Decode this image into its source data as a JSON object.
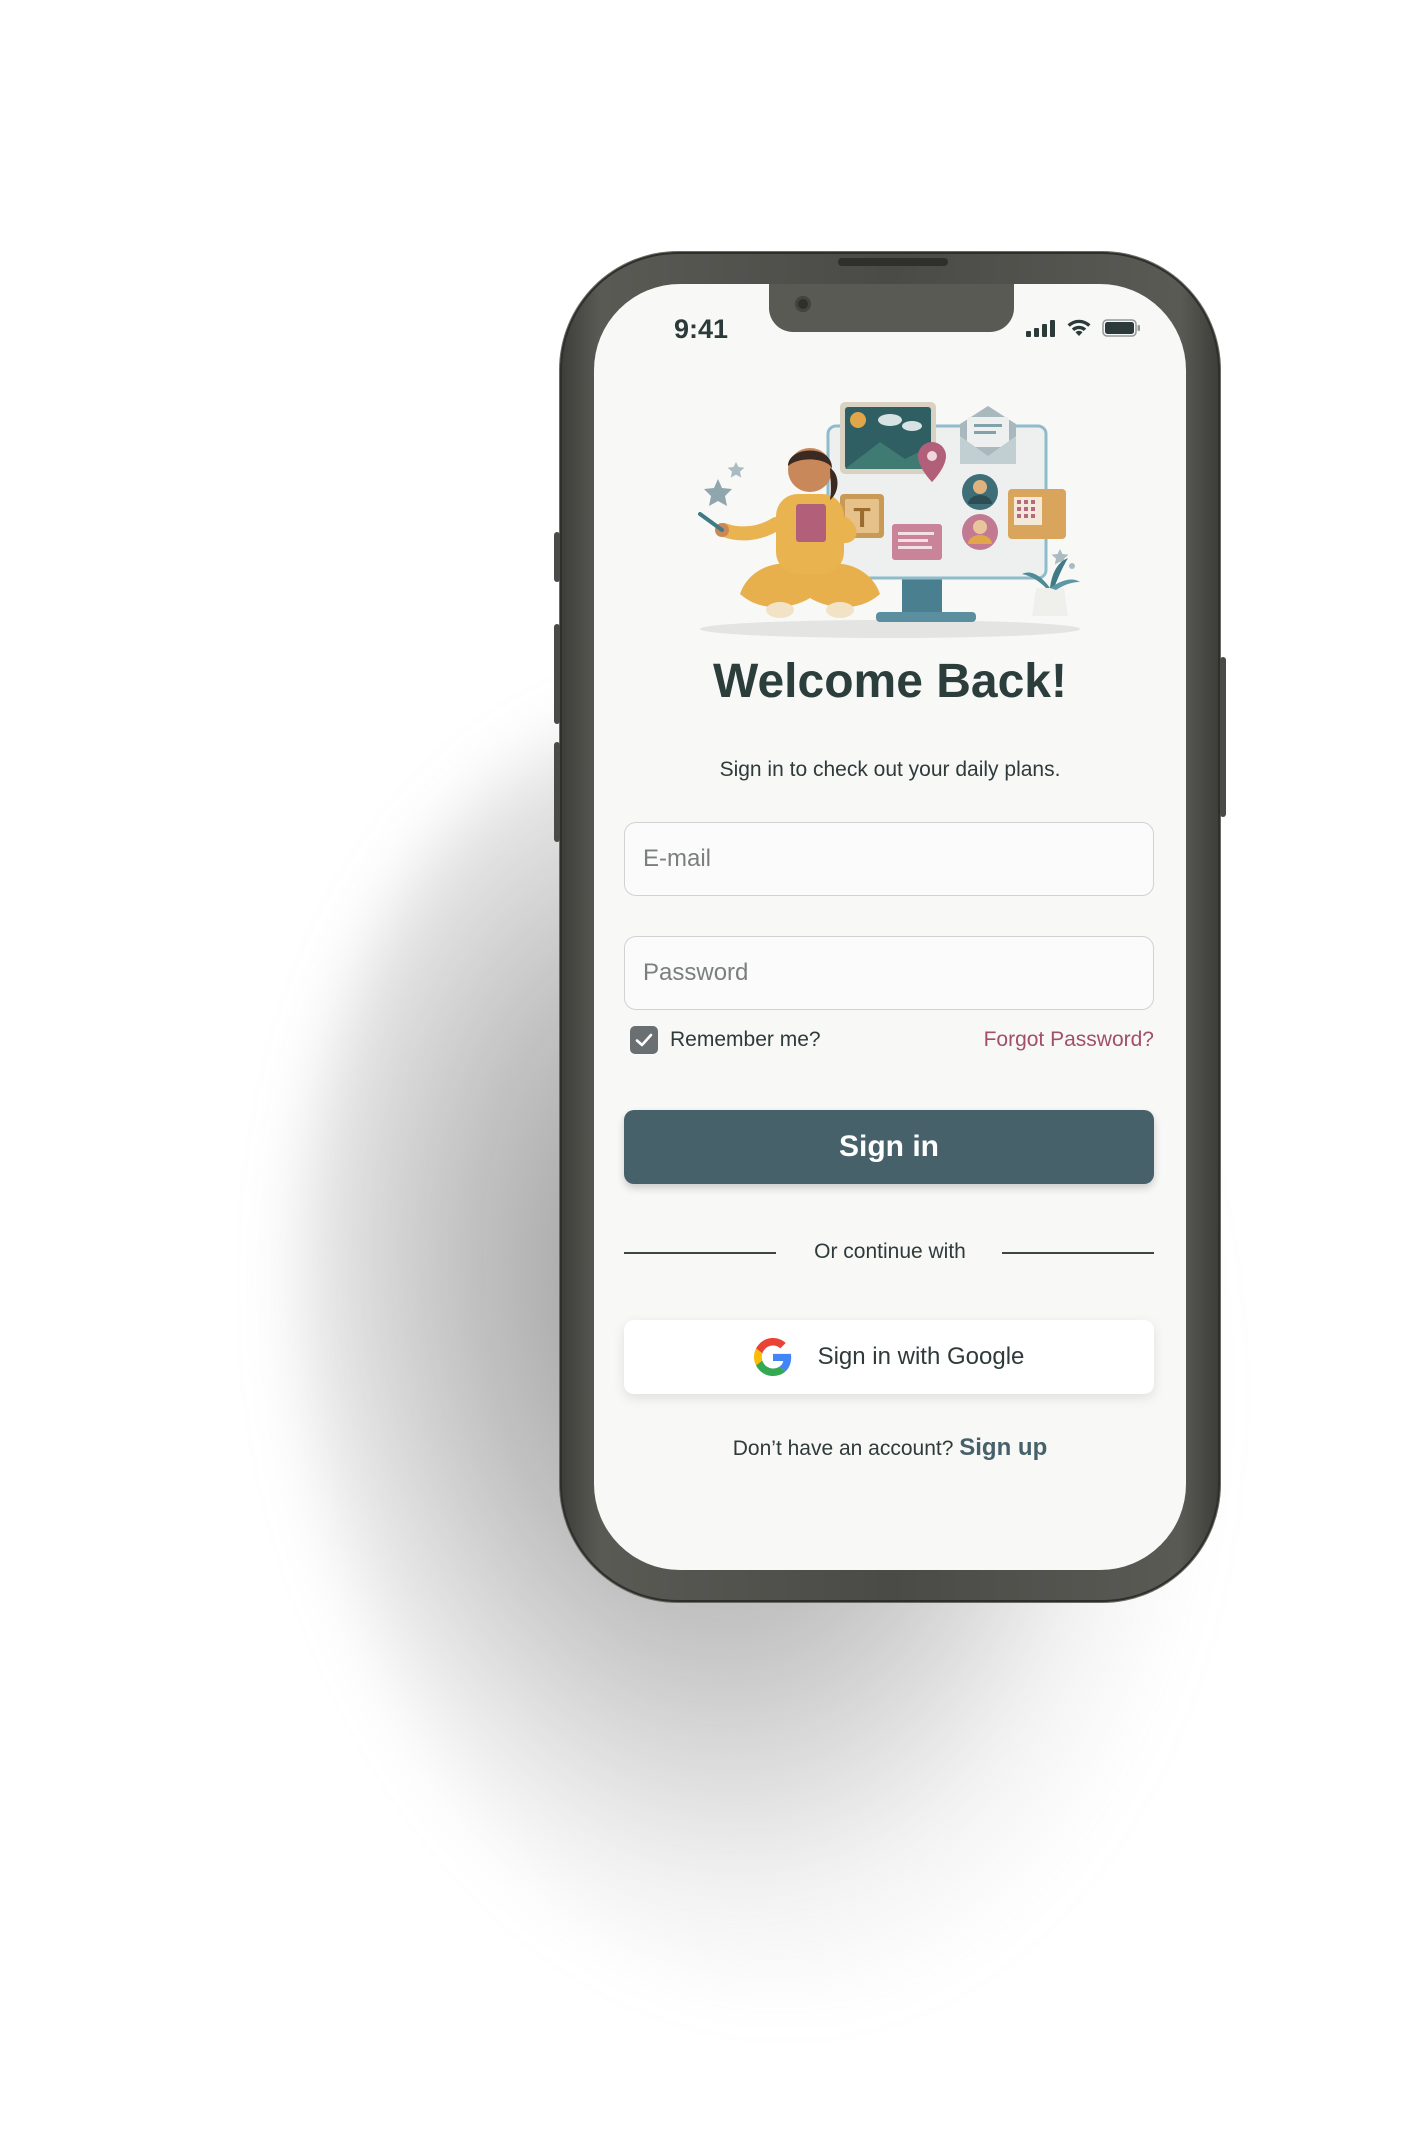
{
  "status_bar": {
    "time": "9:41"
  },
  "hero": {
    "illustration": "person-with-computer-illustration"
  },
  "login": {
    "title": "Welcome Back!",
    "subtitle": "Sign in to check out your daily plans.",
    "email_placeholder": "E-mail",
    "email_value": "",
    "password_placeholder": "Password",
    "password_value": "",
    "remember_label": "Remember me?",
    "remember_checked": true,
    "forgot_label": "Forgot Password?",
    "signin_label": "Sign in",
    "divider_label": "Or continue with",
    "google_label": "Sign in with Google",
    "footer_prompt": "Don’t have an account?",
    "signup_label": "Sign up"
  },
  "colors": {
    "primary": "#47616a",
    "accent_link": "#a24f6a",
    "title": "#2c3e3c",
    "screen_bg": "#f8f8f7",
    "phone_frame": "#4a4a46"
  },
  "icons": {
    "checkbox": "checkmark-icon",
    "google": "google-icon",
    "signal": "signal-icon",
    "wifi": "wifi-icon",
    "battery": "battery-icon"
  }
}
